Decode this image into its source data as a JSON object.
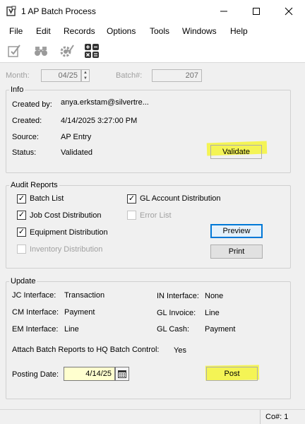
{
  "window": {
    "title": "1 AP Batch Process",
    "minimize": "—",
    "maximize": "☐",
    "close": "✕"
  },
  "menu": [
    "File",
    "Edit",
    "Records",
    "Options",
    "Tools",
    "Windows",
    "Help"
  ],
  "toolbar": {
    "icons": [
      "edit-check-icon",
      "binoculars-icon",
      "gear-check-icon",
      "calculator-icon"
    ]
  },
  "header": {
    "month_label": "Month:",
    "month_value": "04/25",
    "batch_label": "Batch#:",
    "batch_value": "207"
  },
  "info": {
    "legend": "Info",
    "created_by_label": "Created by:",
    "created_by_value": "anya.erkstam@silvertre...",
    "created_label": "Created:",
    "created_value": "4/14/2025 3:27:00 PM",
    "source_label": "Source:",
    "source_value": "AP Entry",
    "status_label": "Status:",
    "status_value": "Validated",
    "validate_button": "Validate"
  },
  "audit": {
    "legend": "Audit Reports",
    "items": {
      "batch_list": {
        "label": "Batch List",
        "checked": true,
        "enabled": true
      },
      "job_cost": {
        "label": "Job Cost Distribution",
        "checked": true,
        "enabled": true
      },
      "equipment": {
        "label": "Equipment Distribution",
        "checked": true,
        "enabled": true
      },
      "inventory": {
        "label": "Inventory Distribution",
        "checked": false,
        "enabled": false
      },
      "gl_account": {
        "label": "GL Account Distribution",
        "checked": true,
        "enabled": true
      },
      "error_list": {
        "label": "Error List",
        "checked": false,
        "enabled": false
      }
    },
    "preview_button": "Preview",
    "print_button": "Print"
  },
  "update": {
    "legend": "Update",
    "jc_label": "JC Interface:",
    "jc_value": "Transaction",
    "cm_label": "CM Interface:",
    "cm_value": "Payment",
    "em_label": "EM Interface:",
    "em_value": "Line",
    "in_label": "IN Interface:",
    "in_value": "None",
    "gl_invoice_label": "GL Invoice:",
    "gl_invoice_value": "Line",
    "gl_cash_label": "GL Cash:",
    "gl_cash_value": "Payment",
    "attach_label": "Attach Batch Reports to HQ Batch Control:",
    "attach_value": "Yes",
    "posting_date_label": "Posting Date:",
    "posting_date_value": "4/14/25",
    "post_button": "Post"
  },
  "status_bar": {
    "company": "Co#: 1"
  }
}
